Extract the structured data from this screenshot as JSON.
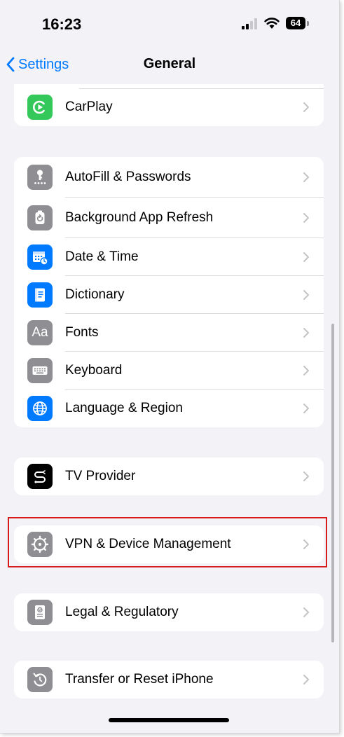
{
  "status_bar": {
    "time": "16:23",
    "battery": "64",
    "icons": [
      "signal-icon",
      "wifi-icon",
      "battery-icon"
    ]
  },
  "nav": {
    "back_label": "Settings",
    "title": "General"
  },
  "groups": [
    {
      "items": [
        {
          "label": "CarPlay",
          "icon": "carplay-icon",
          "icon_color": "#34c759"
        }
      ]
    },
    {
      "items": [
        {
          "label": "AutoFill & Passwords",
          "icon": "key-icon",
          "icon_color": "#8e8e93"
        },
        {
          "label": "Background App Refresh",
          "icon": "refresh-icon",
          "icon_color": "#8e8e93"
        },
        {
          "label": "Date & Time",
          "icon": "calendar-clock-icon",
          "icon_color": "#007aff"
        },
        {
          "label": "Dictionary",
          "icon": "book-icon",
          "icon_color": "#007aff"
        },
        {
          "label": "Fonts",
          "icon": "fonts-icon",
          "icon_text": "Aa",
          "icon_color": "#8e8e93"
        },
        {
          "label": "Keyboard",
          "icon": "keyboard-icon",
          "icon_color": "#8e8e93"
        },
        {
          "label": "Language & Region",
          "icon": "globe-icon",
          "icon_color": "#007aff"
        }
      ]
    },
    {
      "items": [
        {
          "label": "TV Provider",
          "icon": "tv-provider-icon",
          "icon_color": "#000000"
        }
      ]
    },
    {
      "items": [
        {
          "label": "VPN & Device Management",
          "icon": "gear-icon",
          "icon_color": "#8e8e93",
          "highlighted": true
        }
      ]
    },
    {
      "items": [
        {
          "label": "Legal & Regulatory",
          "icon": "legal-document-icon",
          "icon_color": "#8e8e93"
        }
      ]
    },
    {
      "items": [
        {
          "label": "Transfer or Reset iPhone",
          "icon": "reset-icon",
          "icon_color": "#8e8e93"
        }
      ]
    }
  ],
  "colors": {
    "accent": "#007aff",
    "background": "#f2f2f7",
    "highlight_border": "#d71a1a",
    "chevron": "#c4c4c6"
  }
}
